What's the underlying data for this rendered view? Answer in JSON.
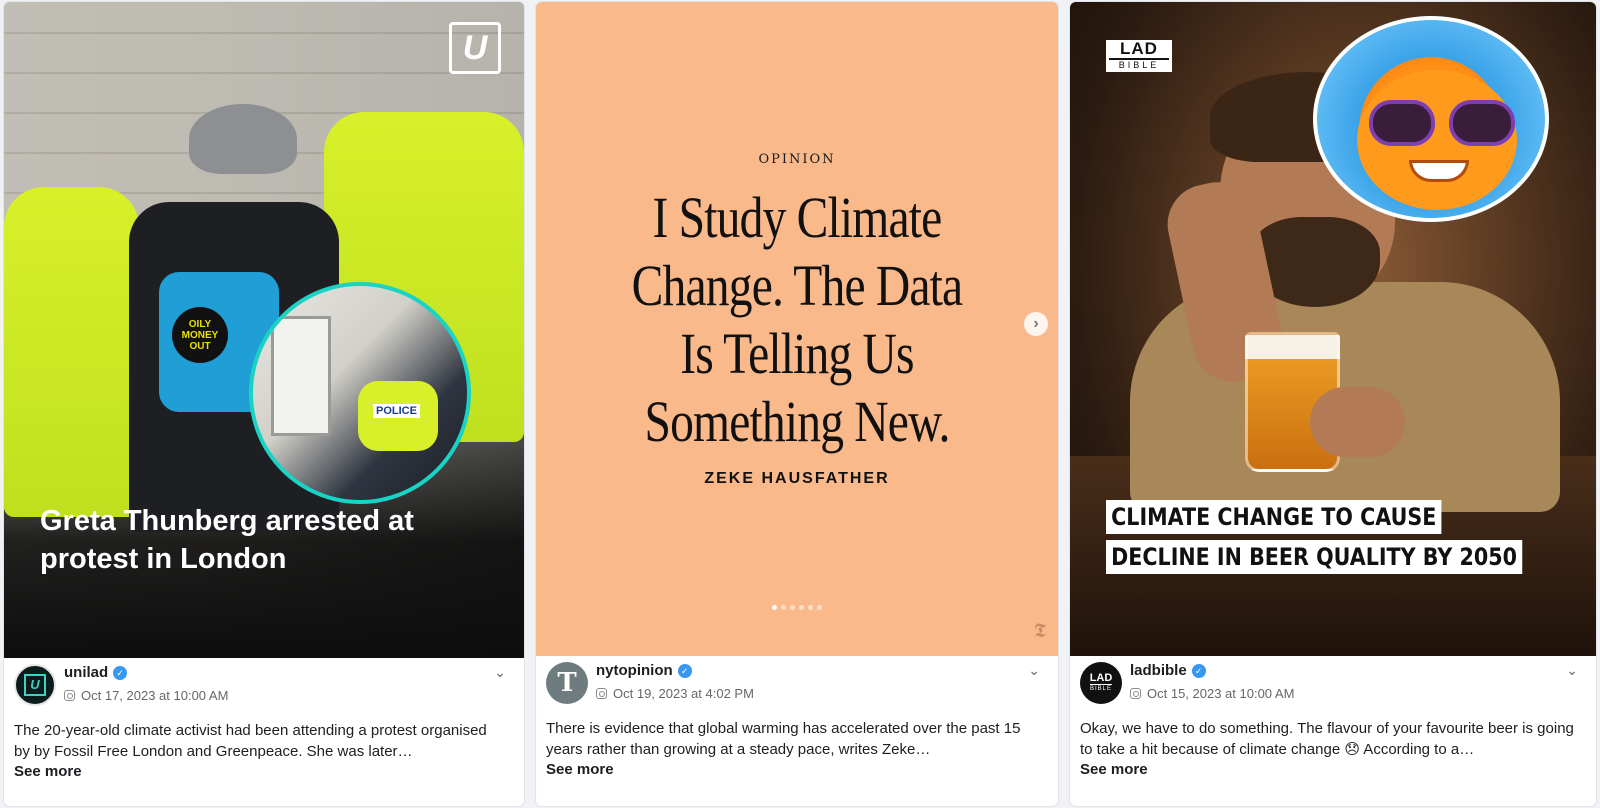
{
  "posts": [
    {
      "headline": "Greta Thunberg arrested at protest in London",
      "badge": "U",
      "pin_text": "OILY MONEY OUT",
      "inset_label": "POLICE",
      "author": "unilad",
      "avatar_text": "U",
      "date": "Oct 17, 2023 at 10:00 AM",
      "caption": "The 20-year-old climate activist had been attending a protest organised by by Fossil Free London and Greenpeace.  She was later…",
      "see_more": "See more"
    },
    {
      "kicker": "OPINION",
      "headline": "I Study Climate Change. The Data Is Telling Us Something New.",
      "byline": "ZEKE HAUSFATHER",
      "next_icon": "›",
      "logo": "𝕿",
      "author": "nytopinion",
      "avatar_text": "T",
      "date": "Oct 19, 2023 at 4:02 PM",
      "caption": "There is evidence that global warming has accelerated over the past 15 years rather than growing at a steady pace, writes Zeke…",
      "see_more": "See more"
    },
    {
      "logo_top": "LAD",
      "logo_bottom": "BIBLE",
      "headline_line1": "CLIMATE CHANGE TO CAUSE",
      "headline_line2": "DECLINE IN BEER QUALITY BY 2050",
      "author": "ladbible",
      "avatar_top": "LAD",
      "avatar_bottom": "BIBLE",
      "date": "Oct 15, 2023 at 10:00 AM",
      "caption": "Okay, we have to do something.  The flavour of your favourite beer is going to take a hit because of climate change 😞  According to a…",
      "see_more": "See more"
    }
  ],
  "icons": {
    "verified": "verified-badge-icon",
    "platform": "instagram-icon",
    "options": "chevron-down-icon"
  },
  "colors": {
    "nyt_bg": "#f9b98a",
    "verified": "#3897f0",
    "unilad_ring": "#19d3c5"
  }
}
